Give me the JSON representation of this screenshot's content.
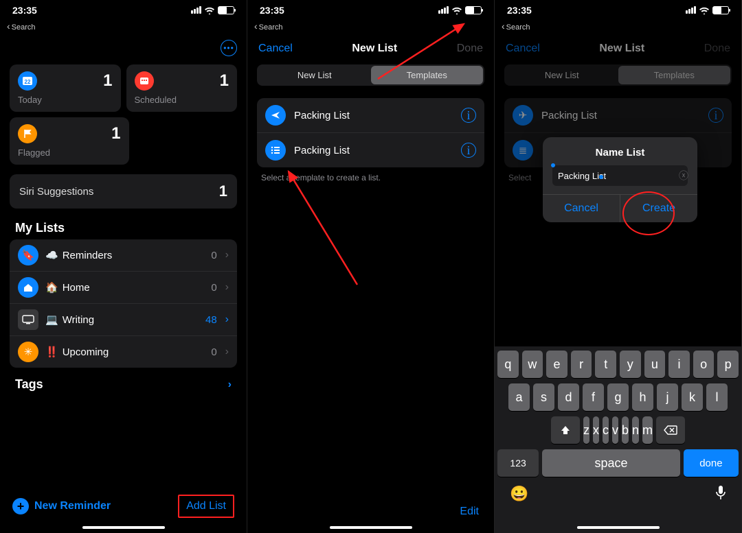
{
  "status": {
    "time": "23:35",
    "back": "Search"
  },
  "screen1": {
    "cards": [
      {
        "label": "Today",
        "count": "1"
      },
      {
        "label": "Scheduled",
        "count": "1"
      },
      {
        "label": "Flagged",
        "count": "1"
      }
    ],
    "siri": {
      "label": "Siri Suggestions",
      "count": "1"
    },
    "mylists_title": "My Lists",
    "lists": [
      {
        "emoji": "☁️",
        "label": "Reminders",
        "count": "0"
      },
      {
        "emoji": "🏠",
        "label": "Home",
        "count": "0"
      },
      {
        "emoji": "💻",
        "label": "Writing",
        "count": "48"
      },
      {
        "emoji": "‼️",
        "label": "Upcoming",
        "count": "0"
      }
    ],
    "tags": "Tags",
    "new_reminder": "New Reminder",
    "add_list": "Add List"
  },
  "screen2": {
    "cancel": "Cancel",
    "title": "New List",
    "done": "Done",
    "seg_newlist": "New List",
    "seg_templates": "Templates",
    "templates": [
      {
        "label": "Packing List"
      },
      {
        "label": "Packing List"
      }
    ],
    "hint": "Select a template to create a list.",
    "edit": "Edit"
  },
  "screen3": {
    "cancel": "Cancel",
    "title": "New List",
    "done": "Done",
    "seg_newlist": "New List",
    "seg_templates": "Templates",
    "template0": "Packing List",
    "hint": "Select",
    "modal": {
      "title": "Name List",
      "value": "Packing List",
      "cancel": "Cancel",
      "create": "Create"
    },
    "kb": {
      "row1": [
        "q",
        "w",
        "e",
        "r",
        "t",
        "y",
        "u",
        "i",
        "o",
        "p"
      ],
      "row2": [
        "a",
        "s",
        "d",
        "f",
        "g",
        "h",
        "j",
        "k",
        "l"
      ],
      "row3": [
        "z",
        "x",
        "c",
        "v",
        "b",
        "n",
        "m"
      ],
      "num": "123",
      "space": "space",
      "done": "done"
    }
  }
}
